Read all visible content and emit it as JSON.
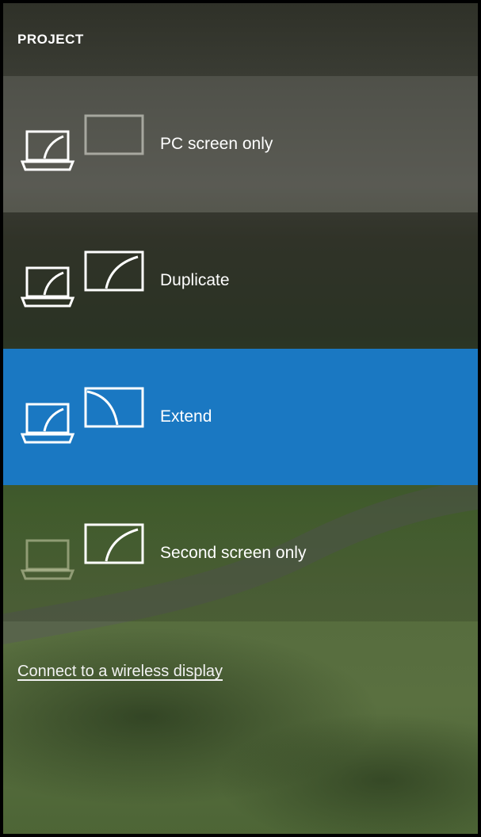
{
  "panel": {
    "title": "PROJECT",
    "accent_color": "#1a78c2"
  },
  "options": [
    {
      "label": "PC screen only",
      "icon": "pc-screen-only-icon",
      "selected": false
    },
    {
      "label": "Duplicate",
      "icon": "duplicate-icon",
      "selected": false
    },
    {
      "label": "Extend",
      "icon": "extend-icon",
      "selected": true
    },
    {
      "label": "Second screen only",
      "icon": "second-screen-only-icon",
      "selected": false
    }
  ],
  "wireless_link": {
    "label": "Connect to a wireless display"
  }
}
